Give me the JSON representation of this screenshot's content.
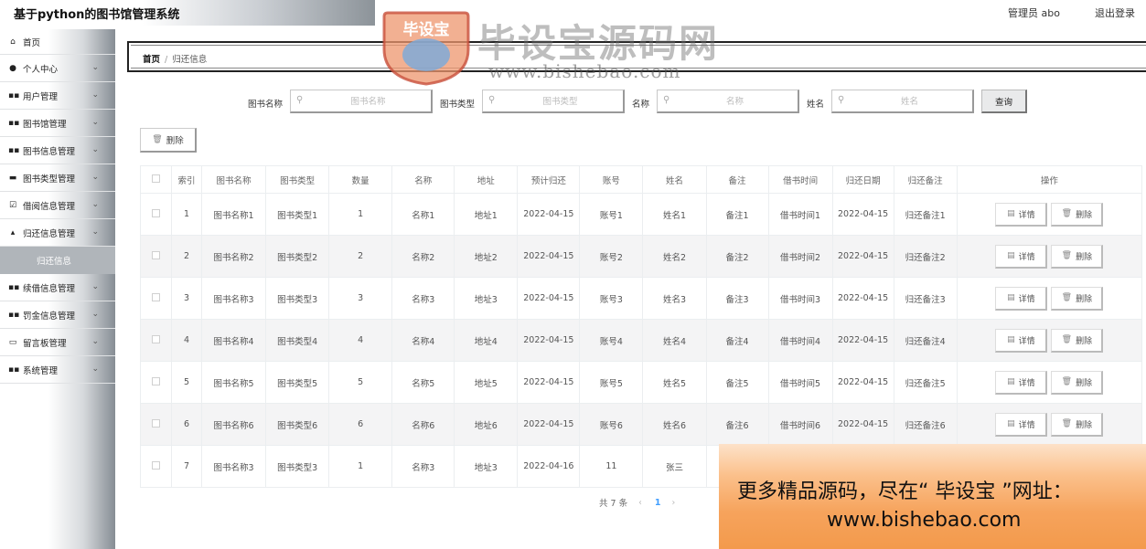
{
  "header": {
    "title": "基于python的图书馆管理系统",
    "user": "管理员 abo",
    "logout": "退出登录"
  },
  "sidebar": {
    "items": [
      {
        "label": "首页",
        "icon": "home-icon",
        "glyph": "⌂",
        "arrow": false
      },
      {
        "label": "个人中心",
        "icon": "person-icon",
        "glyph": "●",
        "arrow": true
      },
      {
        "label": "用户管理",
        "icon": "grid-icon",
        "glyph": "▪▪",
        "arrow": true
      },
      {
        "label": "图书馆管理",
        "icon": "grid-icon",
        "glyph": "▪▪",
        "arrow": true
      },
      {
        "label": "图书信息管理",
        "icon": "grid-icon",
        "glyph": "▪▪",
        "arrow": true
      },
      {
        "label": "图书类型管理",
        "icon": "comment-icon",
        "glyph": "▬",
        "arrow": true
      },
      {
        "label": "借阅信息管理",
        "icon": "checkbox-icon",
        "glyph": "☑",
        "arrow": true
      },
      {
        "label": "归还信息管理",
        "icon": "thumbs-up-icon",
        "glyph": "▴",
        "arrow": true
      },
      {
        "label": "续借信息管理",
        "icon": "grid-icon",
        "glyph": "▪▪",
        "arrow": true
      },
      {
        "label": "罚金信息管理",
        "icon": "grid-icon",
        "glyph": "▪▪",
        "arrow": true
      },
      {
        "label": "留言板管理",
        "icon": "inbox-icon",
        "glyph": "▭",
        "arrow": true
      },
      {
        "label": "系统管理",
        "icon": "grid-icon",
        "glyph": "▪▪",
        "arrow": true
      }
    ],
    "active_sub": "归还信息"
  },
  "breadcrumb": {
    "home": "首页",
    "separator": "/",
    "current": "归还信息"
  },
  "search": {
    "fields": [
      {
        "label": "图书名称",
        "placeholder": "图书名称"
      },
      {
        "label": "图书类型",
        "placeholder": "图书类型"
      },
      {
        "label": "名称",
        "placeholder": "名称"
      },
      {
        "label": "姓名",
        "placeholder": "姓名"
      }
    ],
    "query_button": "查询"
  },
  "toolbar": {
    "delete_label": "删除"
  },
  "table": {
    "headers": [
      "索引",
      "图书名称",
      "图书类型",
      "数量",
      "名称",
      "地址",
      "预计归还",
      "账号",
      "姓名",
      "备注",
      "借书时间",
      "归还日期",
      "归还备注",
      "操作"
    ],
    "rows": [
      [
        "1",
        "图书名称1",
        "图书类型1",
        "1",
        "名称1",
        "地址1",
        "2022-04-15",
        "账号1",
        "姓名1",
        "备注1",
        "借书时间1",
        "2022-04-15",
        "归还备注1"
      ],
      [
        "2",
        "图书名称2",
        "图书类型2",
        "2",
        "名称2",
        "地址2",
        "2022-04-15",
        "账号2",
        "姓名2",
        "备注2",
        "借书时间2",
        "2022-04-15",
        "归还备注2"
      ],
      [
        "3",
        "图书名称3",
        "图书类型3",
        "3",
        "名称3",
        "地址3",
        "2022-04-15",
        "账号3",
        "姓名3",
        "备注3",
        "借书时间3",
        "2022-04-15",
        "归还备注3"
      ],
      [
        "4",
        "图书名称4",
        "图书类型4",
        "4",
        "名称4",
        "地址4",
        "2022-04-15",
        "账号4",
        "姓名4",
        "备注4",
        "借书时间4",
        "2022-04-15",
        "归还备注4"
      ],
      [
        "5",
        "图书名称5",
        "图书类型5",
        "5",
        "名称5",
        "地址5",
        "2022-04-15",
        "账号5",
        "姓名5",
        "备注5",
        "借书时间5",
        "2022-04-15",
        "归还备注5"
      ],
      [
        "6",
        "图书名称6",
        "图书类型6",
        "6",
        "名称6",
        "地址6",
        "2022-04-15",
        "账号6",
        "姓名6",
        "备注6",
        "借书时间6",
        "2022-04-15",
        "归还备注6"
      ],
      [
        "7",
        "图书名称3",
        "图书类型3",
        "1",
        "名称3",
        "地址3",
        "2022-04-16",
        "11",
        "张三",
        "",
        "",
        "",
        ""
      ]
    ],
    "detail_label": "详情",
    "delete_label": "删除"
  },
  "pagination": {
    "total": "共 7 条",
    "prev": "‹",
    "page": "1",
    "next": "›"
  },
  "watermark": {
    "logo_text": "毕设宝",
    "site_name": "毕设宝源码网",
    "url": "www.bishebao.com",
    "promo_line1": "更多精品源码，尽在“ 毕设宝 ”网址：",
    "promo_line2": "www.bishebao.com"
  }
}
